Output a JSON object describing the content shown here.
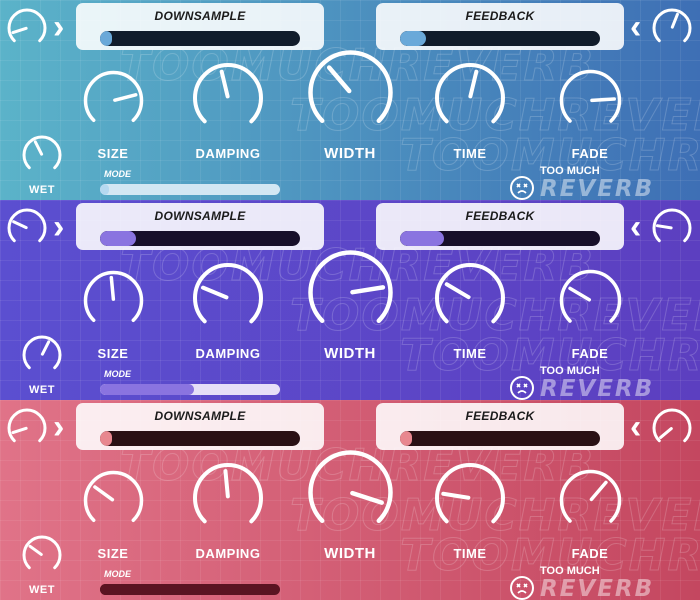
{
  "labels": {
    "downsample": "DOWNSAMPLE",
    "feedback": "FEEDBACK",
    "size": "SIZE",
    "damping": "DAMPING",
    "width": "WIDTH",
    "time": "TIME",
    "fade": "FADE",
    "wet": "WET",
    "mode": "MODE",
    "brand_small": "TOO MUCH",
    "brand_big": "REVERB",
    "bg_text": "TOOMUCHREVERB"
  },
  "icons": {
    "prev": "chevron-right-icon",
    "next": "chevron-left-icon",
    "logo": "sad-face-icon"
  },
  "panels": [
    {
      "name": "blue",
      "colors": {
        "bg_from": "#5bb3c9",
        "bg_to": "#3e6fb5",
        "bar_track": "#101c2b",
        "bar_fill": "#6aa9d9",
        "mode_track": "#d3e7f3",
        "mode_fill": "#b6d9f0"
      },
      "downsample": 0.05,
      "feedback": 0.13,
      "mode": 0.02,
      "knobs": {
        "left": 0.1,
        "size": 0.78,
        "damping": 0.45,
        "width": 0.35,
        "time": 0.55,
        "fade": 0.82,
        "wet": 0.4,
        "right": 0.58
      }
    },
    {
      "name": "purple",
      "colors": {
        "bg_from": "#5b4fd0",
        "bg_to": "#5c3fc0",
        "bar_track": "#170f2a",
        "bar_fill": "#8a74e0",
        "mode_track": "#e6e0f7",
        "mode_fill": "#8a74e0"
      },
      "downsample": 0.18,
      "feedback": 0.22,
      "mode": 0.52,
      "knobs": {
        "left": 0.26,
        "size": 0.48,
        "damping": 0.25,
        "width": 0.8,
        "time": 0.28,
        "fade": 0.28,
        "wet": 0.6,
        "right": 0.2
      }
    },
    {
      "name": "red",
      "colors": {
        "bg_from": "#e07388",
        "bg_to": "#c44760",
        "bar_track": "#2a1014",
        "bar_fill": "#e8878f",
        "mode_track": "#5a1422",
        "mode_fill": "#5a1422"
      },
      "downsample": 0.05,
      "feedback": 0.05,
      "mode": 0.0,
      "knobs": {
        "left": 0.1,
        "size": 0.3,
        "damping": 0.48,
        "width": 0.9,
        "time": 0.2,
        "fade": 0.65,
        "wet": 0.3,
        "right": 0.02
      }
    }
  ]
}
